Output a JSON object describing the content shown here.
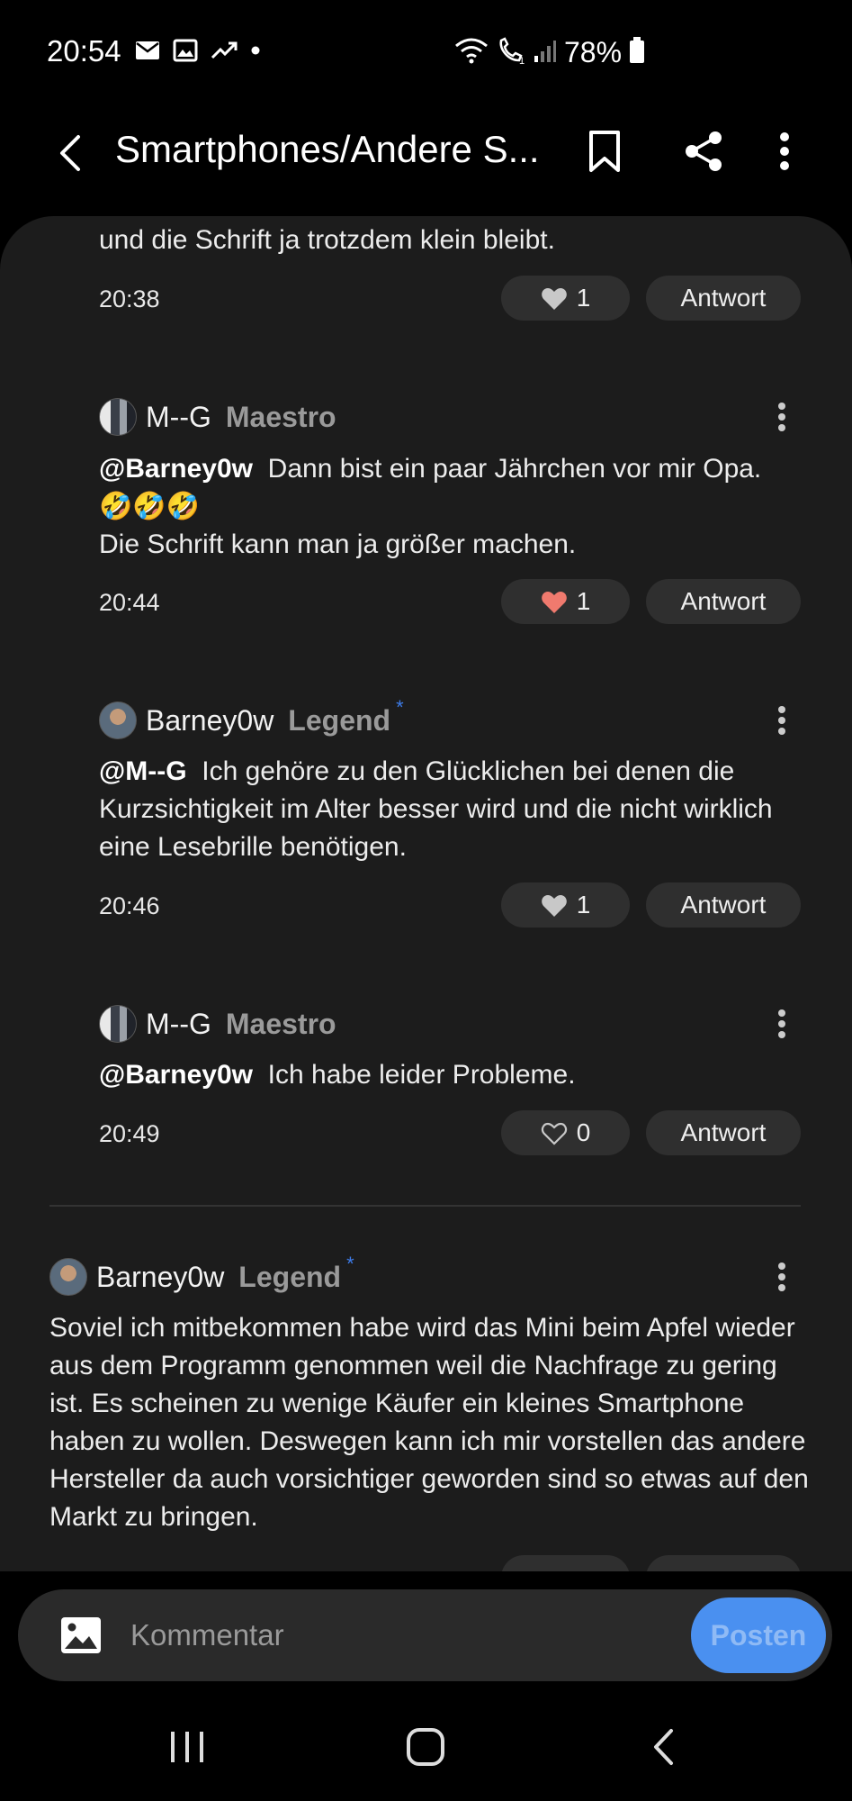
{
  "status_bar": {
    "time": "20:54",
    "left_icons": [
      "mail-icon",
      "image-icon",
      "trend-icon",
      "dot-icon"
    ],
    "right_icons": [
      "wifi-icon",
      "wifi-call-icon",
      "signal-icon",
      "battery-icon"
    ],
    "battery": "78%"
  },
  "app_bar": {
    "title": "Smartphones/Andere S...",
    "icons": [
      "back-icon",
      "bookmark-icon",
      "share-icon",
      "more-vert-icon"
    ]
  },
  "comments": [
    {
      "body_tail": "und die Schrift ja trotzdem klein bleibt.",
      "time": "20:38",
      "likes": "1",
      "liked": false,
      "reply_label": "Antwort"
    },
    {
      "author": "M--G",
      "rank": "Maestro",
      "mention": "@Barney0w",
      "text_line1": "Dann bist ein paar Jährchen vor mir Opa.",
      "emojis": "🤣🤣🤣",
      "text_line2": "Die Schrift kann man ja größer machen.",
      "time": "20:44",
      "likes": "1",
      "liked": true,
      "reply_label": "Antwort"
    },
    {
      "author": "Barney0w",
      "rank": "Legend",
      "rank_mark": "*",
      "mention": "@M--G",
      "text": "Ich gehöre zu den Glücklichen bei denen die Kurzsichtigkeit im Alter besser wird und die nicht wirklich eine Lesebrille benötigen.",
      "time": "20:46",
      "likes": "1",
      "liked": false,
      "reply_label": "Antwort"
    },
    {
      "author": "M--G",
      "rank": "Maestro",
      "mention": "@Barney0w",
      "text": "Ich habe leider Probleme.",
      "time": "20:49",
      "likes": "0",
      "liked": false,
      "reply_label": "Antwort"
    },
    {
      "author": "Barney0w",
      "rank": "Legend",
      "rank_mark": "*",
      "text": "Soviel ich mitbekommen habe wird das Mini beim Apfel wieder aus dem Programm genommen weil die Nachfrage zu gering ist. Es scheinen zu wenige Käufer ein kleines Smartphone haben zu wollen. Deswegen kann ich mir vorstellen das andere Hersteller da auch vorsichtiger geworden sind so etwas auf den Markt zu bringen."
    }
  ],
  "input_bar": {
    "placeholder": "Kommentar",
    "post_label": "Posten"
  },
  "nav_bar": {
    "icons": [
      "recents-icon",
      "home-icon",
      "back-nav-icon"
    ]
  },
  "colors": {
    "background": "#000000",
    "card": "#1c1c1c",
    "pill": "#2f2f2f",
    "liked_heart": "#f07a6e",
    "accent": "#4a90f0",
    "rank_mark": "#3d7be8"
  }
}
